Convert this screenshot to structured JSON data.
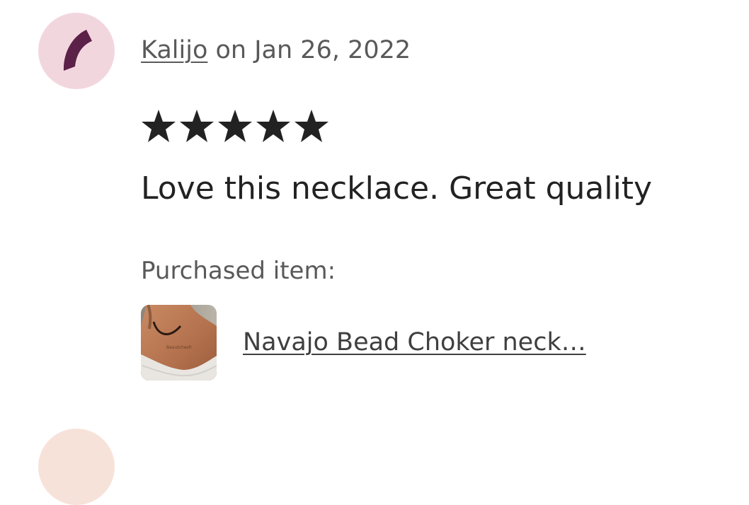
{
  "review": {
    "avatar": {
      "icon": "crescent-c-icon",
      "background_color": "#f2d6de",
      "glyph_color": "#5c2148"
    },
    "username": "Kalijo",
    "date_text": " on Jan 26, 2022",
    "rating": 5,
    "rating_max": 5,
    "star_icon": "star-icon",
    "text": "Love this necklace. Great quality",
    "purchased_label": "Purchased item:",
    "item": {
      "thumbnail_icon": "product-photo-thumbnail",
      "thumbnail_watermark": "Beautchesfr",
      "title": "Navajo Bead Choker neck…"
    }
  },
  "next_review": {
    "avatar_color": "#f7e2da"
  }
}
